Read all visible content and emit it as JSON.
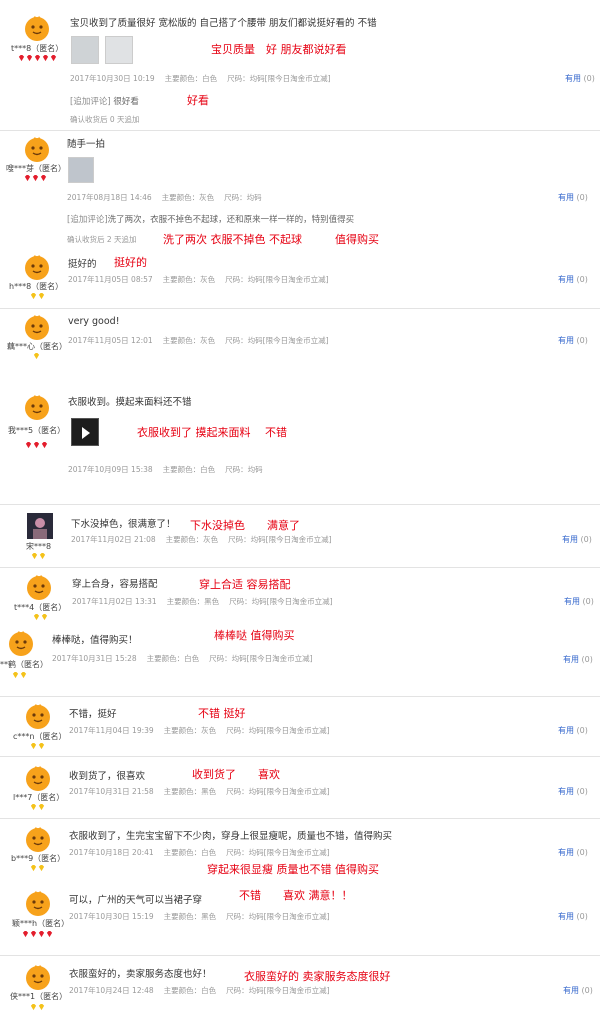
{
  "ui": {
    "useful": "有用",
    "useful_count": "(0)",
    "color_prefix": "主要颜色：",
    "size_prefix": "尺码：",
    "follow_up_tag": "[追加评论]"
  },
  "reviews": [
    {
      "user": "t***8（匿名）",
      "badge": "red",
      "content": "宝贝收到了质量很好 宽松版的 自己搭了个腰带 朋友们都说挺好看的 不错",
      "note": "宝贝质量　好 朋友都说好看",
      "date": "2017年10月30日 10:19",
      "color": "白色",
      "size": "均码[限今日淘金币立减]",
      "followup": "很好看",
      "followup_note": "好看",
      "followup_time": "确认收货后 0 天追加"
    },
    {
      "user": "嗖***芽（匿名）",
      "badge": "red",
      "content": "随手一拍",
      "date": "2017年08月18日 14:46",
      "color": "灰色",
      "size": "均码",
      "followup": "洗了两次，衣服不掉色不起球，还和原来一样一样的，特别值得买",
      "followup_note": "洗了两次 衣服不掉色 不起球　　　值得购买",
      "followup_time": "确认收货后 2 天追加"
    },
    {
      "user": "h***8（匿名）",
      "badge": "yellow",
      "content": "挺好的",
      "note": "挺好的",
      "date": "2017年11月05日 08:57",
      "color": "灰色",
      "size": "均码[限今日淘金币立减]"
    },
    {
      "user": "藕***心（匿名）",
      "badge": "yellow",
      "content": "very good!",
      "date": "2017年11月05日 12:01",
      "color": "灰色",
      "size": "均码[限今日淘金币立减]"
    },
    {
      "user": "我***5（匿名）",
      "badge": "red",
      "content": "衣服收到。摸起来面料还不错",
      "note": "衣服收到了 摸起来面料　 不错",
      "date": "2017年10月09日 15:38",
      "color": "白色",
      "size": "均码"
    },
    {
      "user": "宋***8",
      "badge": "yellow",
      "content": "下水没掉色，很满意了！",
      "note": "下水没掉色　　满意了",
      "date": "2017年11月02日 21:08",
      "color": "灰色",
      "size": "均码[限今日淘金币立减]"
    },
    {
      "user": "t***4（匿名）",
      "badge": "yellow",
      "content": "穿上合身，容易搭配",
      "note": "穿上合适 容易搭配",
      "date": "2017年11月02日 13:31",
      "color": "黑色",
      "size": "均码[限今日淘金币立减]"
    },
    {
      "user": "**鹤（匿名）",
      "badge": "yellow",
      "content": "棒棒哒，值得购买！",
      "note": "棒棒哒 值得购买",
      "date": "2017年10月31日 15:28",
      "color": "白色",
      "size": "均码[限今日淘金币立减]"
    },
    {
      "user": "c***n（匿名）",
      "badge": "yellow",
      "content": "不错，挺好",
      "note": "不错 挺好",
      "date": "2017年11月04日 19:39",
      "color": "灰色",
      "size": "均码[限今日淘金币立减]"
    },
    {
      "user": "l***7（匿名）",
      "badge": "yellow",
      "content": "收到货了，很喜欢",
      "note": "收到货了　　喜欢",
      "date": "2017年10月31日 21:58",
      "color": "黑色",
      "size": "均码[限今日淘金币立减]"
    },
    {
      "user": "b***9（匿名）",
      "badge": "yellow",
      "content": "衣服收到了，生完宝宝留下不少肉，穿身上很显瘦呢，质量也不错，值得购买",
      "note": "穿起来很显瘦 质量也不错 值得购买",
      "date": "2017年10月18日 20:41",
      "color": "白色",
      "size": "均码[限今日淘金币立减]"
    },
    {
      "user": "颖***h（匿名）",
      "badge": "red",
      "content": "可以，广州的天气可以当裙子穿",
      "note": "不错　　喜欢 满意！！",
      "date": "2017年10月30日 15:19",
      "color": "黑色",
      "size": "均码[限今日淘金币立减]"
    },
    {
      "user": "侠***1（匿名）",
      "badge": "yellow",
      "content": "衣服蛮好的，卖家服务态度也好！",
      "note": "衣服蛮好的 卖家服务态度很好",
      "date": "2017年10月24日 12:48",
      "color": "白色",
      "size": "均码[限今日淘金币立减]"
    }
  ]
}
